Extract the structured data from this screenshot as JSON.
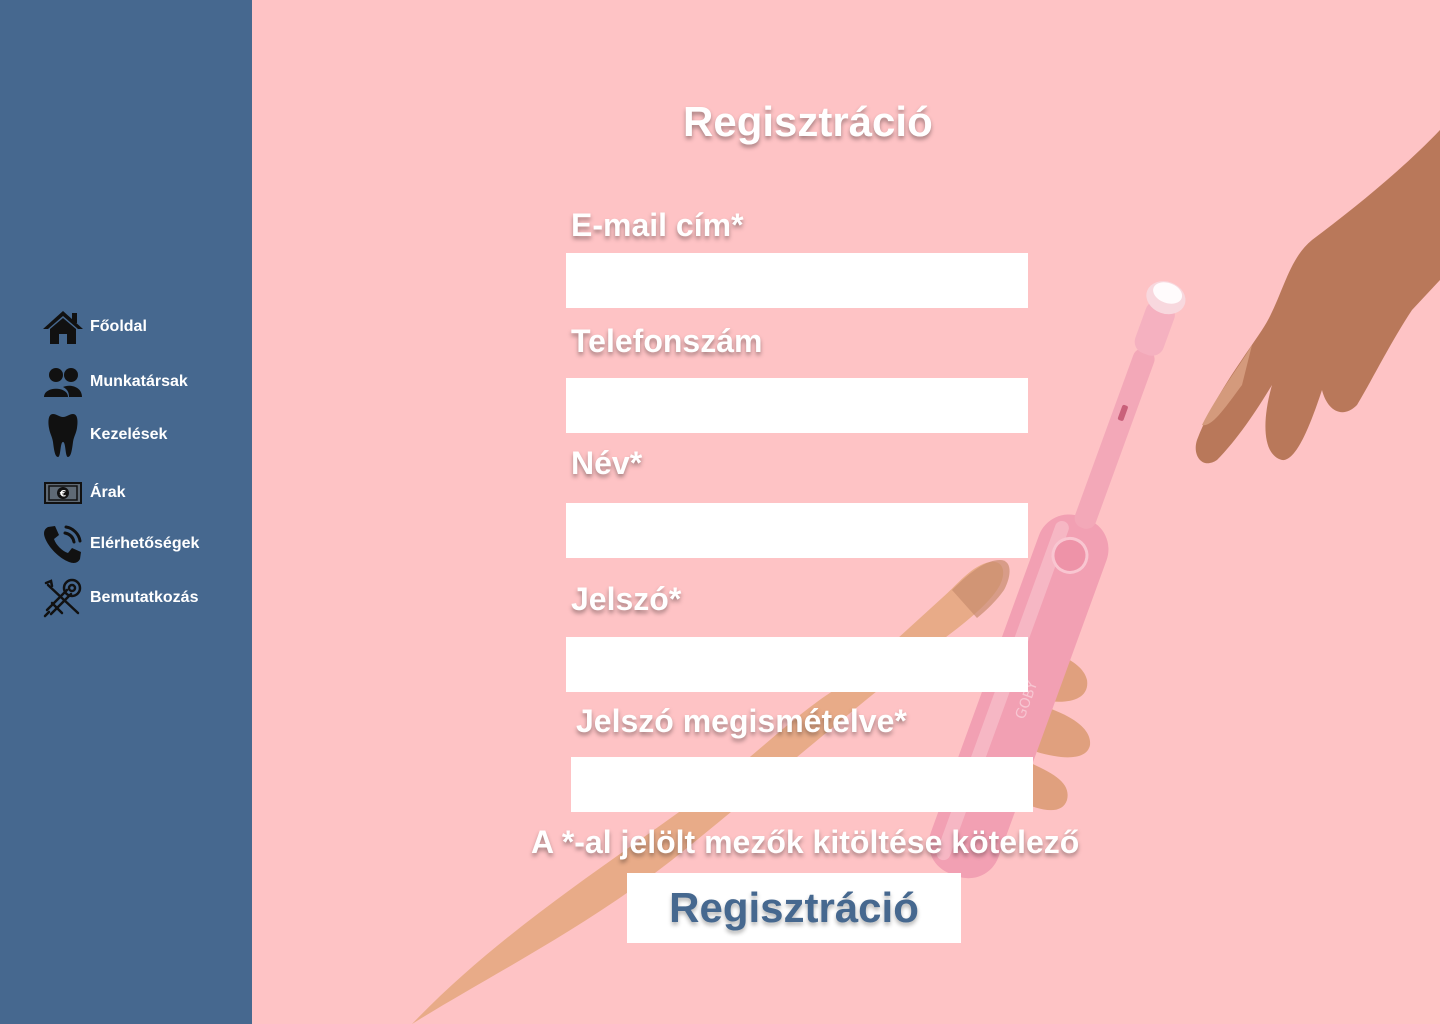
{
  "sidebar": {
    "items": [
      {
        "label": "Főoldal",
        "icon": "home-icon"
      },
      {
        "label": "Munkatársak",
        "icon": "users-icon"
      },
      {
        "label": "Kezelések",
        "icon": "tooth-icon"
      },
      {
        "label": "Árak",
        "icon": "euro-banknote-icon"
      },
      {
        "label": "Elérhetőségek",
        "icon": "phone-icon"
      },
      {
        "label": "Bemutatkozás",
        "icon": "tools-icon"
      }
    ]
  },
  "form": {
    "title": "Regisztráció",
    "email_label": "E-mail cím*",
    "phone_label": "Telefonszám",
    "name_label": "Név*",
    "password_label": "Jelszó*",
    "password_repeat_label": "Jelszó megismételve*",
    "required_note": "A *-al jelölt mezők kitöltése kötelező",
    "submit_label": "Regisztráció"
  },
  "illustration": {
    "brand_text": "GOBY"
  },
  "colors": {
    "background": "#fec3c5",
    "sidebar": "#46688f",
    "field": "#ffffff",
    "accent_text": "#46688f"
  }
}
